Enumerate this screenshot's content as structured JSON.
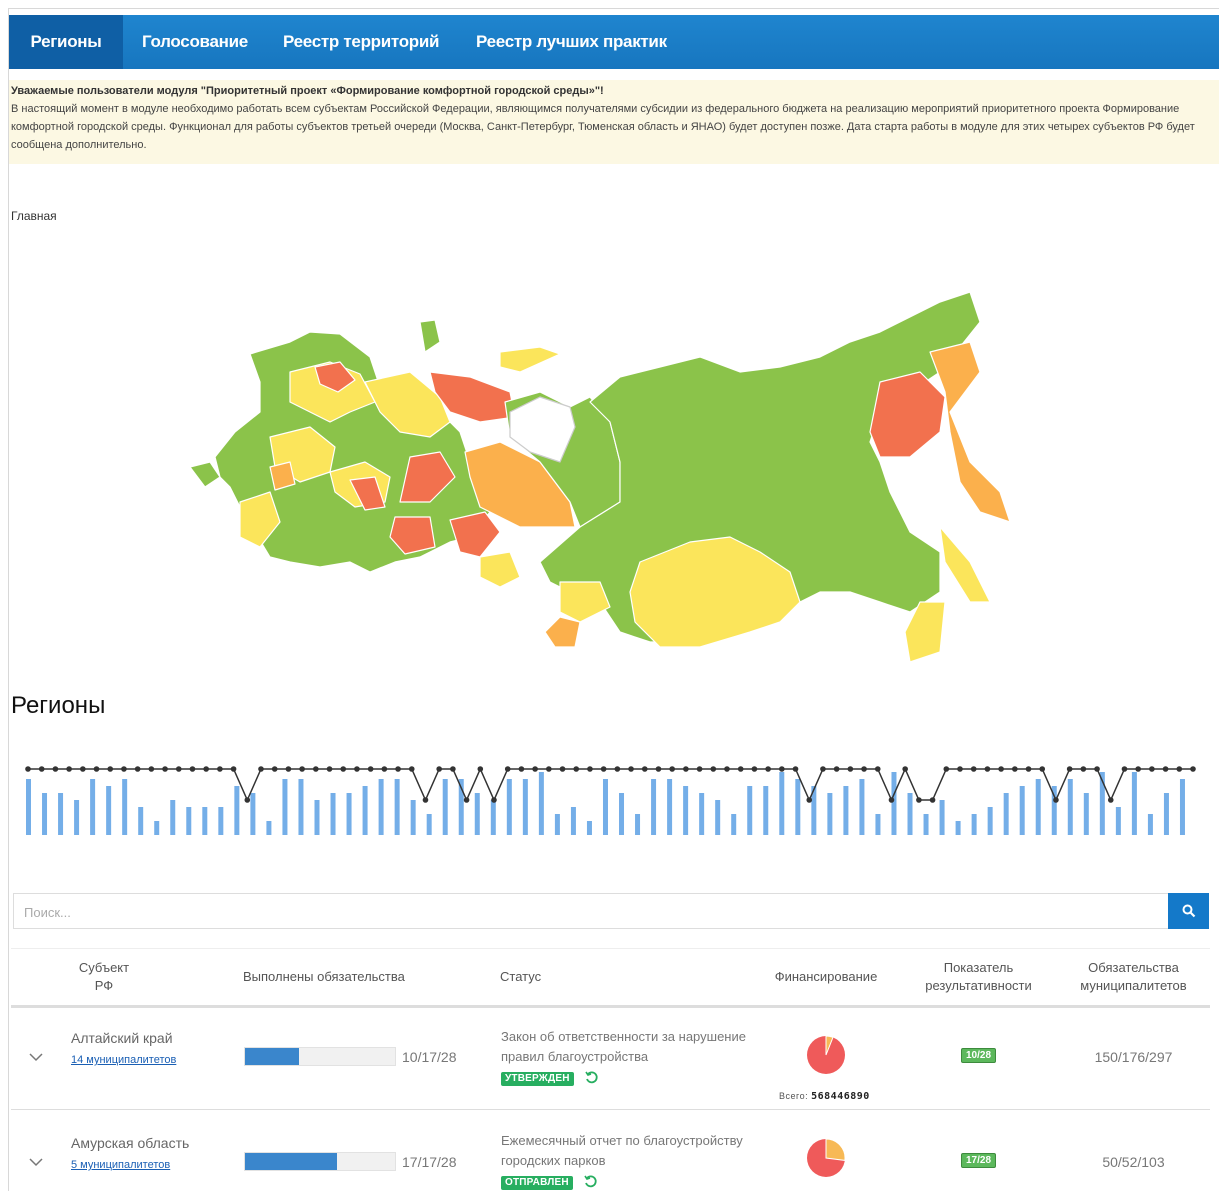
{
  "nav": {
    "items": [
      {
        "label": "Регионы",
        "active": true
      },
      {
        "label": "Голосование",
        "active": false
      },
      {
        "label": "Реестр территорий",
        "active": false
      },
      {
        "label": "Реестр лучших практик",
        "active": false
      }
    ]
  },
  "notice": {
    "heading": "Уважаемые пользователи модуля \"Приоритетный проект «Формирование комфортной городской среды»\"!",
    "body": "В настоящий момент в модуле необходимо работать всем субъектам Российской Федерации, являющимся получателями субсидии из федерального бюджета на реализацию мероприятий приоритетного проекта Формирование комфортной городской среды. Функционал для работы субъектов третьей очереди (Москва, Санкт-Петербург, Тюменская область и ЯНАО) будет доступен позже. Дата старта работы в модуле для этих четырех субъектов РФ будет сообщена дополнительно."
  },
  "breadcrumb": "Главная",
  "section_title": "Регионы",
  "colors": {
    "green": "#8bc34a",
    "yellow": "#fbe55b",
    "orange": "#fbb04c",
    "red": "#f2714e",
    "white": "#ffffff",
    "bar": "#74aee8"
  },
  "sparkline": {
    "bars": [
      8,
      6,
      6,
      5,
      8,
      7,
      8,
      4,
      2,
      5,
      4,
      4,
      4,
      7,
      6,
      2,
      8,
      8,
      5,
      6,
      6,
      7,
      8,
      8,
      5,
      3,
      8,
      8,
      6,
      5,
      8,
      8,
      9,
      3,
      4,
      2,
      8,
      6,
      3,
      8,
      8,
      7,
      6,
      5,
      3,
      7,
      7,
      9,
      8,
      7,
      6,
      7,
      8,
      3,
      9,
      6,
      3,
      5,
      2,
      3,
      4,
      6,
      7,
      8,
      7,
      8,
      6,
      9,
      4,
      9,
      3,
      6,
      8
    ],
    "dot_drops": [
      0,
      0,
      0,
      0,
      0,
      0,
      0,
      0,
      0,
      0,
      0,
      0,
      0,
      0,
      0,
      0,
      1,
      0,
      0,
      0,
      0,
      0,
      0,
      0,
      0,
      0,
      0,
      0,
      0,
      1,
      0,
      0,
      1,
      0,
      1,
      0,
      0,
      0,
      0,
      0,
      0,
      0,
      0,
      0,
      0,
      0,
      0,
      0,
      0,
      0,
      0,
      0,
      0,
      0,
      0,
      0,
      0,
      1,
      0,
      0,
      0,
      0,
      0,
      1,
      0,
      1,
      1,
      0,
      0,
      0,
      0,
      0,
      0,
      0,
      0,
      1,
      0,
      0,
      0,
      1,
      0,
      0,
      0,
      0,
      0,
      0
    ]
  },
  "search": {
    "placeholder": "Поиск..."
  },
  "table": {
    "headers": {
      "subject": "Субъект РФ",
      "done": "Выполнены обязательства",
      "status": "Статус",
      "finance": "Финансирование",
      "efficiency": "Показатель результативности",
      "municipal": "Обязательства муниципалитетов"
    },
    "rows": [
      {
        "name": "Алтайский край",
        "link": "14 муниципалитетов",
        "progress_fraction": 0.36,
        "progress_text": "10/17/28",
        "status_text": "Закон об ответственности за нарушение правил благоустройства",
        "status_badge": "УТВЕРЖДЕН",
        "finance_fraction": 0.06,
        "finance_total_label": "Всего:",
        "finance_total": "568446890",
        "efficiency": "10/28",
        "municipal": "150/176/297"
      },
      {
        "name": "Амурская область",
        "link": "5 муниципалитетов",
        "progress_fraction": 0.61,
        "progress_text": "17/17/28",
        "status_text": "Ежемесячный отчет по благоустройству городских парков",
        "status_badge": "ОТПРАВЛЕН",
        "finance_fraction": 0.27,
        "efficiency": "17/28",
        "municipal": "50/52/103"
      }
    ]
  }
}
